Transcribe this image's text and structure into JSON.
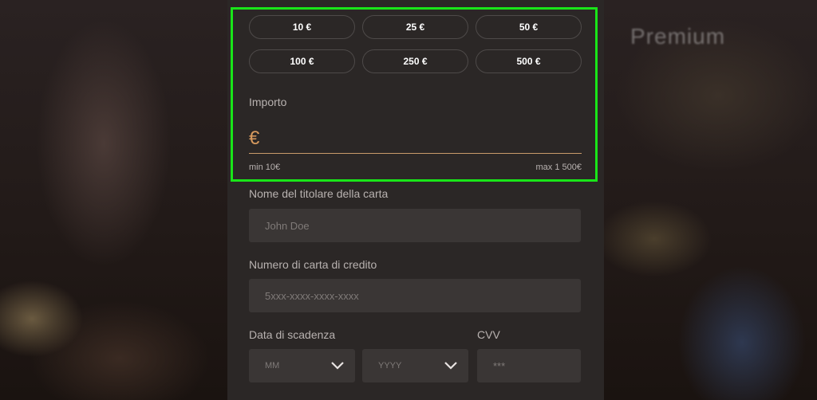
{
  "background": {
    "text": "Premium"
  },
  "amounts": [
    "10 €",
    "25 €",
    "50 €",
    "100 €",
    "250 €",
    "500 €"
  ],
  "amount_field": {
    "label": "Importo",
    "currency_symbol": "€",
    "min": "min 10€",
    "max": "max 1 500€"
  },
  "cardholder": {
    "label": "Nome del titolare della carta",
    "placeholder": "John Doe"
  },
  "card_number": {
    "label": "Numero di carta di credito",
    "placeholder": "5xxx-xxxx-xxxx-xxxx"
  },
  "expiry": {
    "label": "Data di scadenza",
    "month_placeholder": "MM",
    "year_placeholder": "YYYY"
  },
  "cvv": {
    "label": "CVV",
    "placeholder": "***"
  },
  "colors": {
    "accent": "#d89a5e",
    "highlight": "#19e519",
    "panel": "#2b2726"
  }
}
